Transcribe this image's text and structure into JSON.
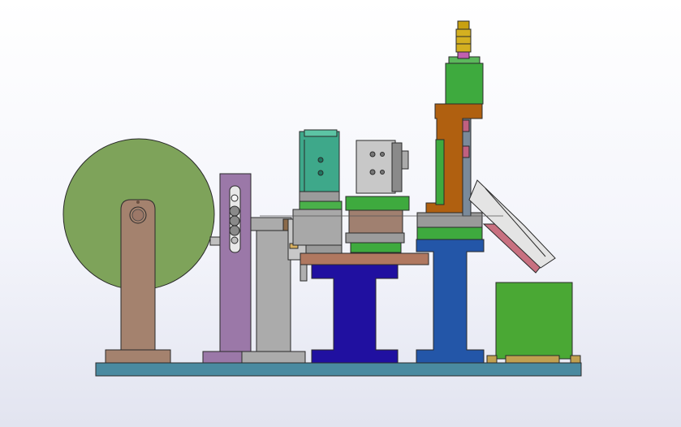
{
  "viewport": {
    "background": "#f0f1f8"
  },
  "colors": {
    "base_plate": "#4a8aa0",
    "spool": "#7ea35a",
    "spool_stand": "#a4826e",
    "guide_roller_stand": "#9b78a8",
    "grey_bracket": "#ababab",
    "blue_pedestal": "#2010a0",
    "press_column": "#2356a8",
    "press_frame": "#b06010",
    "pneumatic_cylinder": "#3ea88a",
    "green_accent": "#3eaa3e",
    "pink_chute": "#c87080",
    "collection_bin": "#4aa834",
    "die_block": "#a08070",
    "feed_rail": "#b07860",
    "fitting_gold": "#d4b020"
  }
}
